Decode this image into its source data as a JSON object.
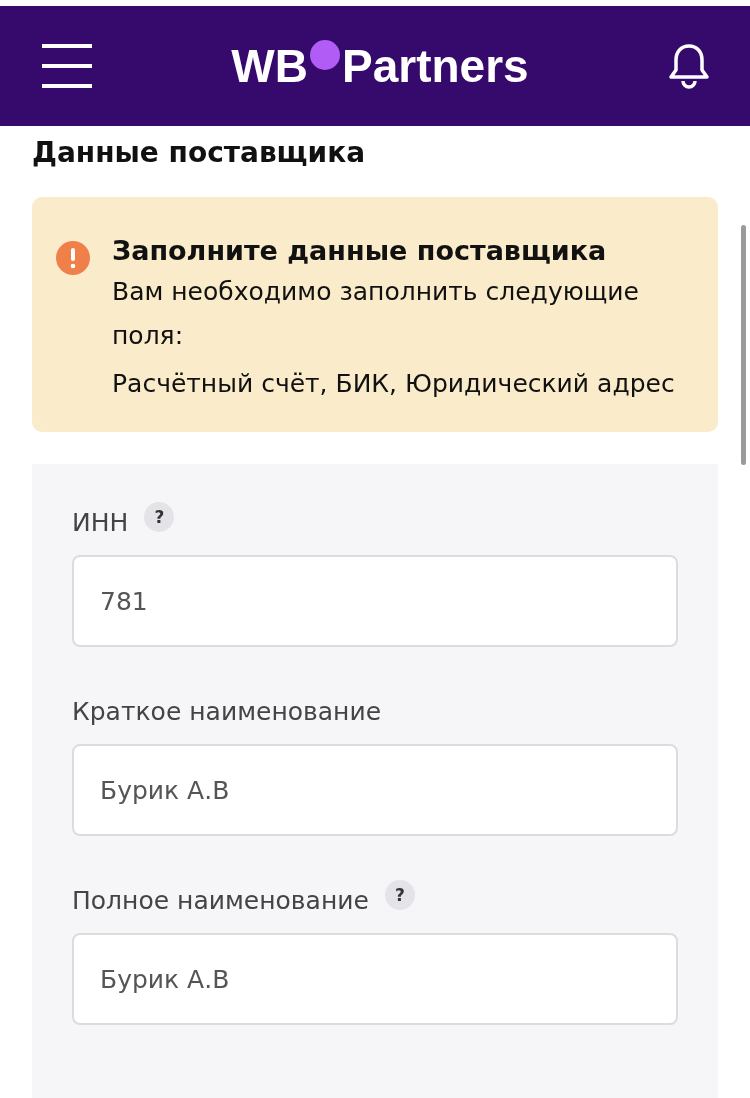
{
  "header": {
    "logo_left": "WB",
    "logo_right": "Partners"
  },
  "page_title": "Данные поставщика",
  "alert": {
    "title": "Заполните данные поставщика",
    "lines": [
      "Вам необходимо заполнить следующие поля:",
      "Расчётный счёт, БИК, Юридический адрес"
    ]
  },
  "fields": [
    {
      "label": "ИНН",
      "help": "?",
      "value": "781"
    },
    {
      "label": "Краткое наименование",
      "value": "Бурик А.В"
    },
    {
      "label": "Полное наименование",
      "help": "?",
      "value": "Бурик А.В"
    }
  ]
}
